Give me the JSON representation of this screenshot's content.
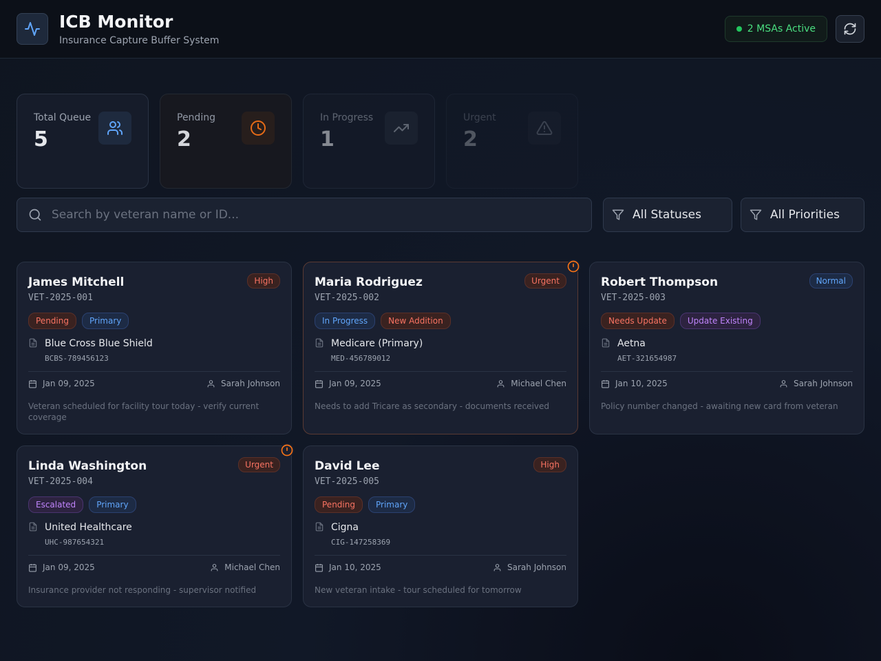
{
  "header": {
    "title": "ICB Monitor",
    "subtitle": "Insurance Capture Buffer System",
    "msa_status": "2 MSAs Active"
  },
  "stats": [
    {
      "label": "Total Queue",
      "value": "5",
      "icon": "users-icon",
      "color": "#60a5fa"
    },
    {
      "label": "Pending",
      "value": "2",
      "icon": "clock-icon",
      "color": "#f97316"
    },
    {
      "label": "In Progress",
      "value": "1",
      "icon": "trending-up-icon",
      "color": "#9ca3af"
    },
    {
      "label": "Urgent",
      "value": "2",
      "icon": "alert-triangle-icon",
      "color": "#9ca3af"
    }
  ],
  "search": {
    "placeholder": "Search by veteran name or ID..."
  },
  "filters": {
    "status": "All Statuses",
    "priority": "All Priorities"
  },
  "cards": [
    {
      "name": "James Mitchell",
      "id": "VET-2025-001",
      "priority": "High",
      "tags": [
        "Pending",
        "Primary"
      ],
      "insurer": "Blue Cross Blue Shield",
      "policy": "BCBS-789456123",
      "date": "Jan 09, 2025",
      "agent": "Sarah Johnson",
      "note": "Veteran scheduled for facility tour today - verify current coverage"
    },
    {
      "name": "Maria Rodriguez",
      "id": "VET-2025-002",
      "priority": "Urgent",
      "tags": [
        "In Progress",
        "New Addition"
      ],
      "insurer": "Medicare (Primary)",
      "policy": "MED-456789012",
      "date": "Jan 09, 2025",
      "agent": "Michael Chen",
      "note": "Needs to add Tricare as secondary - documents received"
    },
    {
      "name": "Robert Thompson",
      "id": "VET-2025-003",
      "priority": "Normal",
      "tags": [
        "Needs Update",
        "Update Existing"
      ],
      "insurer": "Aetna",
      "policy": "AET-321654987",
      "date": "Jan 10, 2025",
      "agent": "Sarah Johnson",
      "note": "Policy number changed - awaiting new card from veteran"
    },
    {
      "name": "Linda Washington",
      "id": "VET-2025-004",
      "priority": "Urgent",
      "tags": [
        "Escalated",
        "Primary"
      ],
      "insurer": "United Healthcare",
      "policy": "UHC-987654321",
      "date": "Jan 09, 2025",
      "agent": "Michael Chen",
      "note": "Insurance provider not responding - supervisor notified"
    },
    {
      "name": "David Lee",
      "id": "VET-2025-005",
      "priority": "High",
      "tags": [
        "Pending",
        "Primary"
      ],
      "insurer": "Cigna",
      "policy": "CIG-147258369",
      "date": "Jan 10, 2025",
      "agent": "Sarah Johnson",
      "note": "New veteran intake - tour scheduled for tomorrow"
    }
  ]
}
